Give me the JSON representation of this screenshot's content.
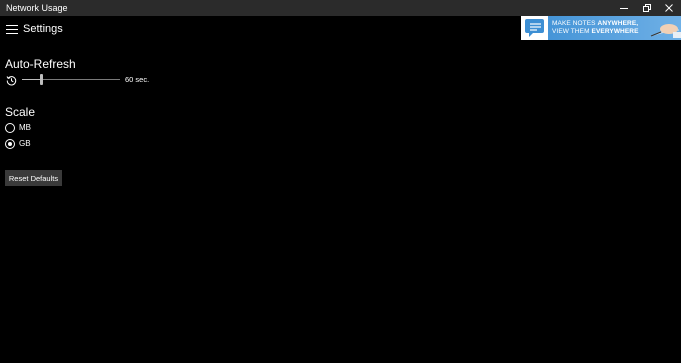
{
  "window": {
    "title": "Network Usage",
    "minimize_icon": "minimize-icon",
    "restore_icon": "restore-icon",
    "close_icon": "close-icon"
  },
  "header": {
    "menu_icon": "hamburger-icon",
    "page_title": "Settings"
  },
  "ad": {
    "line1_prefix": "MAKE NOTES ",
    "line1_emphasis": "ANYWHERE,",
    "line2_prefix": "VIEW THEM ",
    "line2_emphasis": "EVERYWHERE",
    "background": "#3d8fd4"
  },
  "auto_refresh": {
    "title": "Auto-Refresh",
    "icon": "history-icon",
    "value_label": "60 sec.",
    "slider_fraction": 0.2
  },
  "scale": {
    "title": "Scale",
    "options": [
      {
        "label": "MB",
        "selected": false
      },
      {
        "label": "GB",
        "selected": true
      }
    ]
  },
  "reset_button": {
    "label": "Reset Defaults"
  },
  "colors": {
    "background": "#000000",
    "titlebar": "#2b2b2b",
    "button": "#3a3a3a",
    "text": "#ffffff"
  }
}
